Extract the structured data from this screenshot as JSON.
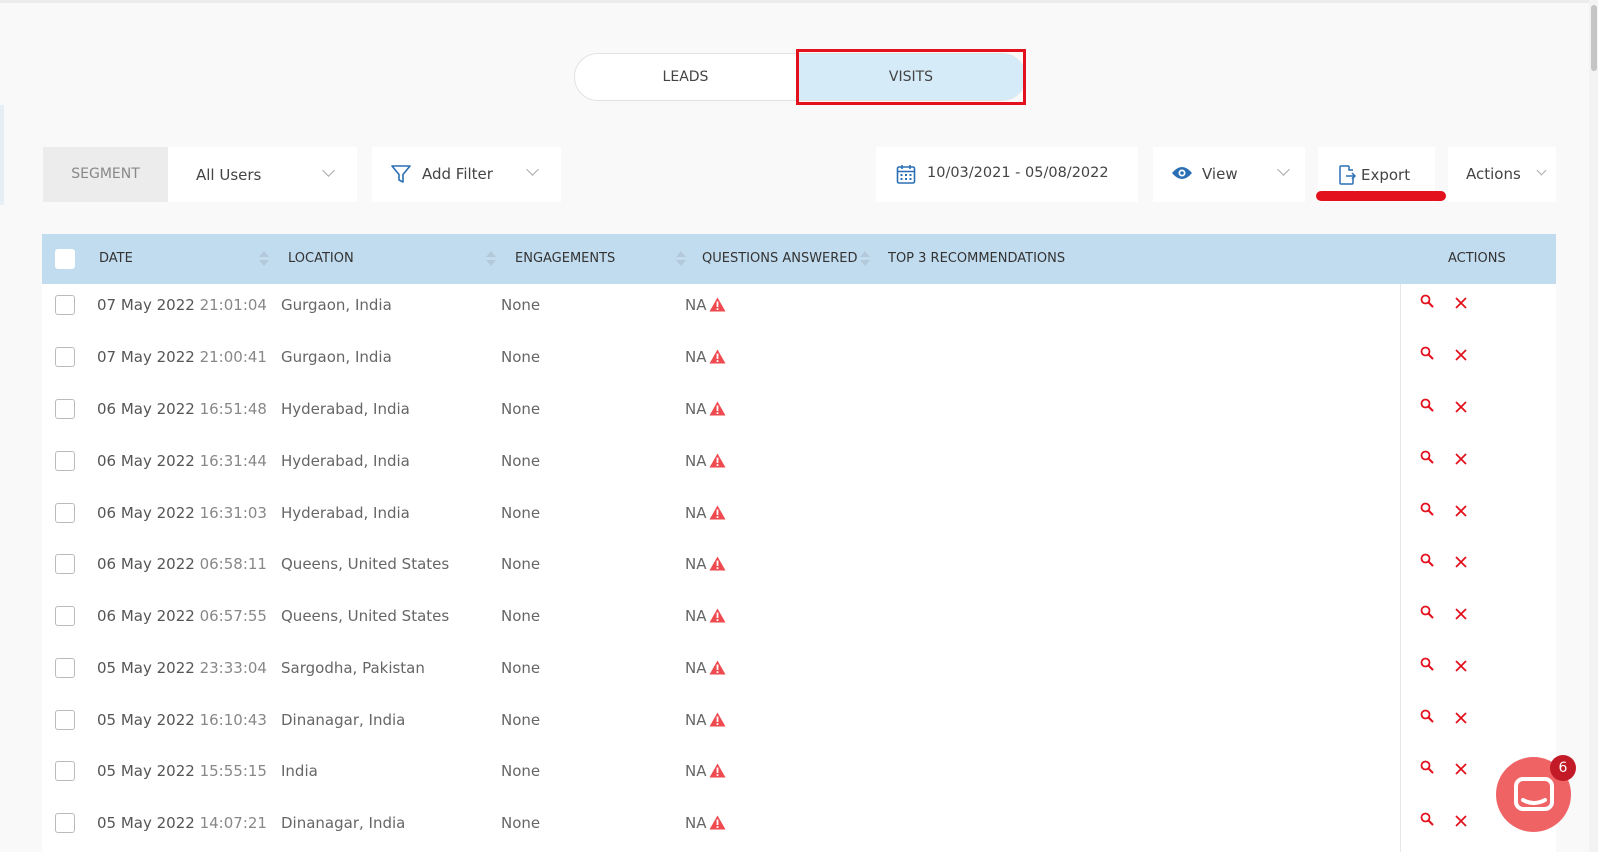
{
  "tabs": {
    "leads_label": "LEADS",
    "visits_label": "VISITS"
  },
  "toolbar": {
    "segment_label": "SEGMENT",
    "segment_value": "All Users",
    "filter_label": "Add Filter",
    "date_range": "10/03/2021 - 05/08/2022",
    "view_label": "View",
    "export_label": "Export",
    "actions_label": "Actions"
  },
  "table": {
    "headers": {
      "date": "DATE",
      "location": "LOCATION",
      "engagements": "ENGAGEMENTS",
      "questions": "QUESTIONS ANSWERED",
      "recommendations": "TOP 3 RECOMMENDATIONS",
      "actions": "ACTIONS"
    },
    "rows": [
      {
        "date": "07 May 2022",
        "time": "21:01:04",
        "location": "Gurgaon, India",
        "engagements": "None",
        "questions": "NA"
      },
      {
        "date": "07 May 2022",
        "time": "21:00:41",
        "location": "Gurgaon, India",
        "engagements": "None",
        "questions": "NA"
      },
      {
        "date": "06 May 2022",
        "time": "16:51:48",
        "location": "Hyderabad, India",
        "engagements": "None",
        "questions": "NA"
      },
      {
        "date": "06 May 2022",
        "time": "16:31:44",
        "location": "Hyderabad, India",
        "engagements": "None",
        "questions": "NA"
      },
      {
        "date": "06 May 2022",
        "time": "16:31:03",
        "location": "Hyderabad, India",
        "engagements": "None",
        "questions": "NA"
      },
      {
        "date": "06 May 2022",
        "time": "06:58:11",
        "location": "Queens, United States",
        "engagements": "None",
        "questions": "NA"
      },
      {
        "date": "06 May 2022",
        "time": "06:57:55",
        "location": "Queens, United States",
        "engagements": "None",
        "questions": "NA"
      },
      {
        "date": "05 May 2022",
        "time": "23:33:04",
        "location": "Sargodha, Pakistan",
        "engagements": "None",
        "questions": "NA"
      },
      {
        "date": "05 May 2022",
        "time": "16:10:43",
        "location": "Dinanagar, India",
        "engagements": "None",
        "questions": "NA"
      },
      {
        "date": "05 May 2022",
        "time": "15:55:15",
        "location": "India",
        "engagements": "None",
        "questions": "NA"
      },
      {
        "date": "05 May 2022",
        "time": "14:07:21",
        "location": "Dinanagar, India",
        "engagements": "None",
        "questions": "NA"
      }
    ]
  },
  "chat": {
    "badge_count": "6"
  },
  "colors": {
    "accent_red": "#e3101e",
    "header_blue": "#c2dcef",
    "tab_active": "#d5ebf8",
    "icon_blue": "#2a6fb4",
    "warn_red": "#ef4a4f"
  }
}
